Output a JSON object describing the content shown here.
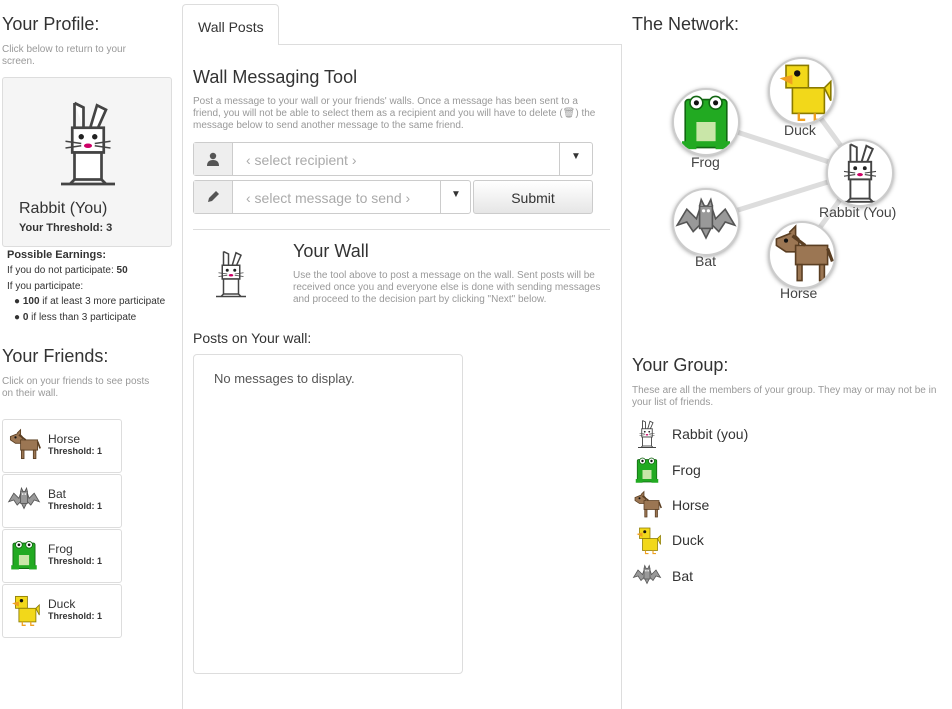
{
  "profile": {
    "title": "Your Profile:",
    "hint": "Click below to return to your screen.",
    "name": "Rabbit (You)",
    "threshold": "Your Threshold: 3",
    "earnings_title": "Possible Earnings:",
    "no_participate_text": "If you do not participate: ",
    "no_participate_value": "50",
    "participate_text": "If you participate:",
    "bullet1_value": "100",
    "bullet1_text": " if at least 3 more participate",
    "bullet2_value": "0",
    "bullet2_text": " if less than 3 participate"
  },
  "friends": {
    "title": "Your Friends:",
    "hint": "Click on your friends to see posts on their wall.",
    "items": [
      {
        "name": "Horse",
        "threshold": "Threshold: 1",
        "icon": "horse-icon"
      },
      {
        "name": "Bat",
        "threshold": "Threshold: 1",
        "icon": "bat-icon"
      },
      {
        "name": "Frog",
        "threshold": "Threshold: 1",
        "icon": "frog-icon"
      },
      {
        "name": "Duck",
        "threshold": "Threshold: 1",
        "icon": "duck-icon"
      }
    ]
  },
  "tab": {
    "label": "Wall Posts"
  },
  "tool": {
    "title": "Wall Messaging Tool",
    "description_1": "Post a message to your wall or your friends' walls. Once a message has been sent to a friend, you will not be able to select them as a recipient and you will have to delete (",
    "description_2": ") the message below to send another message to the same friend.",
    "recipient_placeholder": "‹ select recipient ›",
    "message_placeholder": "‹ select message to send ›",
    "submit_label": "Submit"
  },
  "wall": {
    "title": "Your Wall",
    "description": "Use the tool above to post a message on the wall. Sent posts will be received once you and everyone else is done with sending messages and proceed to the decision part by clicking \"Next\" below.",
    "posts_label": "Posts on Your wall:",
    "empty_text": "No messages to display."
  },
  "network": {
    "title": "The Network:",
    "nodes": [
      {
        "label": "Duck"
      },
      {
        "label": "Frog"
      },
      {
        "label": "Rabbit (You)"
      },
      {
        "label": "Bat"
      },
      {
        "label": "Horse"
      }
    ]
  },
  "group": {
    "title": "Your Group:",
    "hint": "These are all the members of your group. They may or may not be in your list of friends.",
    "members": [
      {
        "name": "Rabbit (you)",
        "icon": "rabbit-icon"
      },
      {
        "name": "Frog",
        "icon": "frog-icon"
      },
      {
        "name": "Horse",
        "icon": "horse-icon"
      },
      {
        "name": "Duck",
        "icon": "duck-icon"
      },
      {
        "name": "Bat",
        "icon": "bat-icon"
      }
    ]
  },
  "colors": {
    "frog": "#22aa22",
    "duck": "#f2d81a",
    "horse": "#9b7653",
    "bat": "#999999",
    "accent_border": "#dddddd"
  }
}
